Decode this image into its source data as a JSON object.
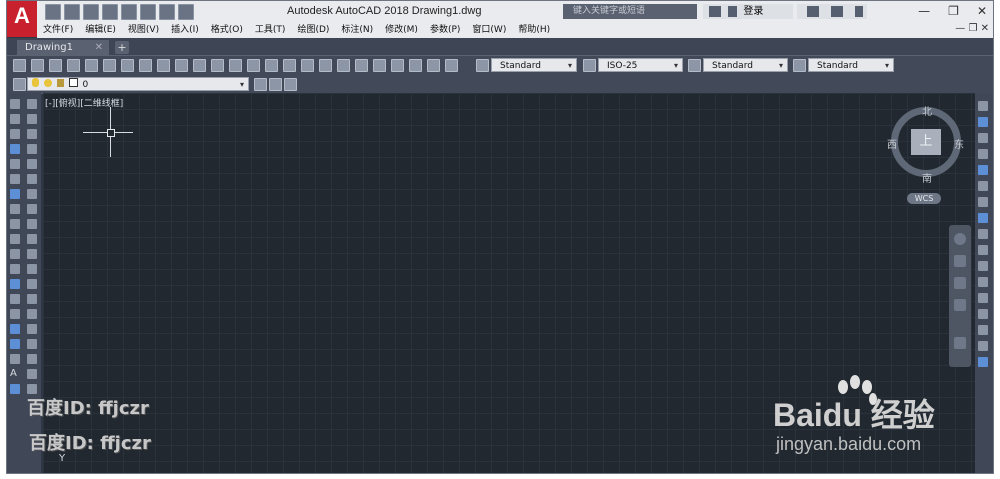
{
  "titlebar": {
    "app_letter": "A",
    "title": "Autodesk AutoCAD 2018    Drawing1.dwg",
    "search_placeholder": "键入关键字或短语",
    "login_label": "登录",
    "window_buttons": [
      "—",
      "❐",
      "✕"
    ]
  },
  "menubar": {
    "items": [
      "文件(F)",
      "编辑(E)",
      "视图(V)",
      "插入(I)",
      "格式(O)",
      "工具(T)",
      "绘图(D)",
      "标注(N)",
      "修改(M)",
      "参数(P)",
      "窗口(W)",
      "帮助(H)"
    ],
    "window_controls": "— ❐ ✕"
  },
  "tabs": {
    "doc_tab": "Drawing1",
    "close": "✕",
    "add": "+"
  },
  "toolbar": {
    "text_style": "Standard",
    "dim_style": "ISO-25",
    "table_style": "Standard",
    "mleader_style": "Standard",
    "layer_value": "0",
    "dropdown_arrow": "▾"
  },
  "canvas": {
    "view_label": "[-][俯视][二维线框]"
  },
  "viewcube": {
    "top_face": "上",
    "north": "北",
    "south": "南",
    "east": "东",
    "west": "西",
    "wcs": "WCS"
  },
  "watermarks": {
    "baidu_id_1": "百度ID: ffjczr",
    "baidu_id_2": "百度ID: ffjczr",
    "baidu_logo": "Baidu 经验",
    "url": "jingyan.baidu.com"
  },
  "colors": {
    "accent": "#c8202c",
    "canvas_bg": "#212830",
    "frame_bg": "#2f3746"
  }
}
